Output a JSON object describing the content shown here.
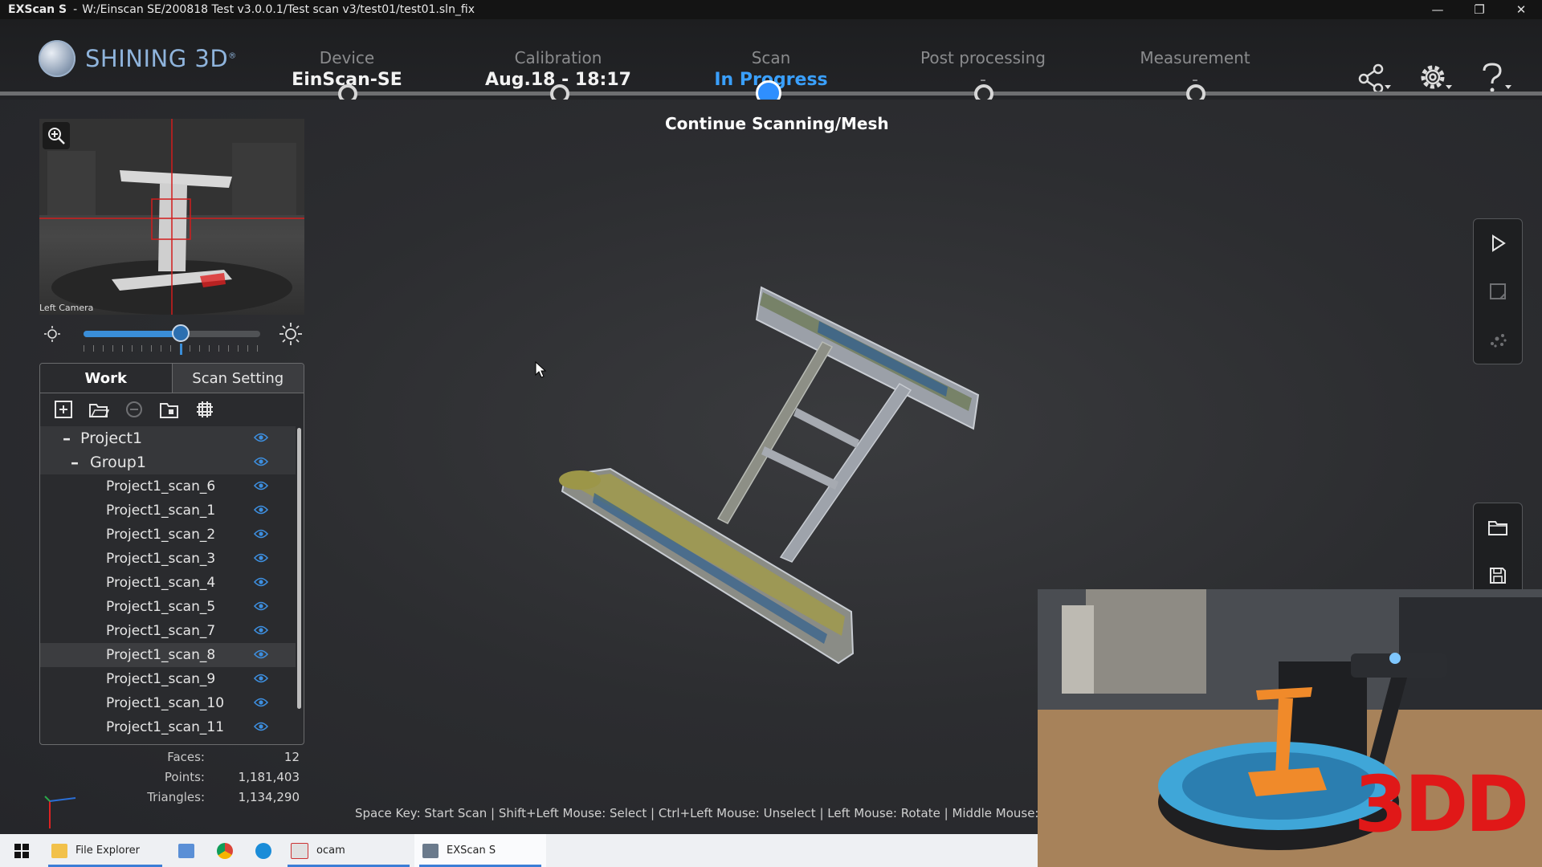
{
  "window": {
    "app": "EXScan S",
    "path": "W:/Einscan SE/200818 Test v3.0.0.1/Test scan v3/test01/test01.sln_fix"
  },
  "brand": {
    "name": "SHINING 3D",
    "reg": "®"
  },
  "steps": [
    {
      "label": "Device",
      "value": "EinScan-SE"
    },
    {
      "label": "Calibration",
      "value": "Aug.18 - 18:17"
    },
    {
      "label": "Scan",
      "value": "In Progress"
    },
    {
      "label": "Post processing",
      "value": "-"
    },
    {
      "label": "Measurement",
      "value": "-"
    }
  ],
  "active_step": 2,
  "hint": "Continue Scanning/Mesh",
  "camera": {
    "label": "Left Camera"
  },
  "brightness": {
    "level": 0.55
  },
  "panel": {
    "tabs": [
      "Work",
      "Scan Setting"
    ],
    "project": "Project1",
    "group": "Group1",
    "scans": [
      "Project1_scan_6",
      "Project1_scan_1",
      "Project1_scan_2",
      "Project1_scan_3",
      "Project1_scan_4",
      "Project1_scan_5",
      "Project1_scan_7",
      "Project1_scan_8",
      "Project1_scan_9",
      "Project1_scan_10",
      "Project1_scan_11"
    ],
    "selected_index": 7
  },
  "stats": {
    "faces_label": "Faces:",
    "faces": "12",
    "points_label": "Points:",
    "points": "1,181,403",
    "triangles_label": "Triangles:",
    "triangles": "1,134,290"
  },
  "statusbar": "Space Key: Start Scan | Shift+Left Mouse: Select | Ctrl+Left Mouse: Unselect | Left Mouse: Rotate | Middle Mouse: Pa",
  "overlay": {
    "logo_text": "3DD"
  },
  "taskbar": {
    "items": [
      "File Explorer",
      "ocam",
      "EXScan S"
    ]
  },
  "colors": {
    "accent": "#3aa0ff",
    "background": "#2a2b2e"
  }
}
